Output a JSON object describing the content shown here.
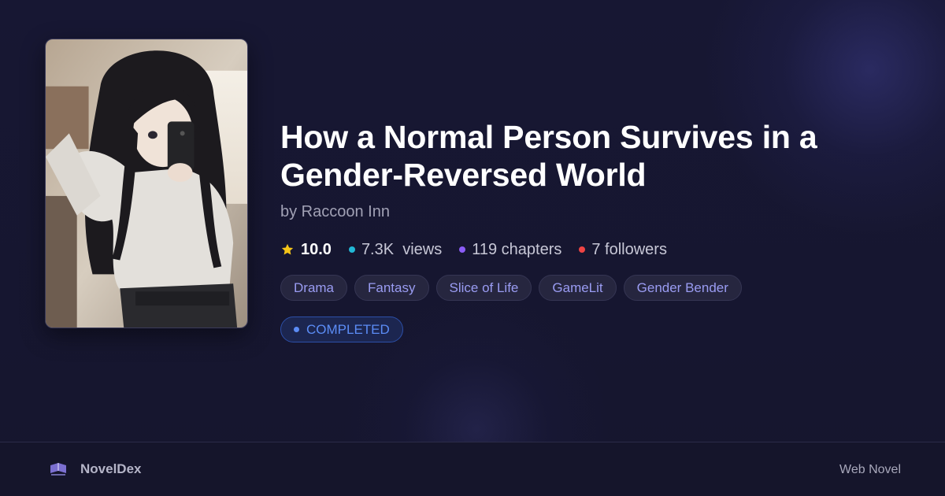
{
  "novel": {
    "title": "How a Normal Person Survives in a Gender-Reversed World",
    "author_line": "by Raccoon Inn",
    "rating": "10.0",
    "views": "7.3K  views",
    "chapters": "119 chapters",
    "followers": "7 followers",
    "genres": [
      "Drama",
      "Fantasy",
      "Slice of Life",
      "GameLit",
      "Gender Bender"
    ],
    "status": "COMPLETED"
  },
  "icons": {
    "rating": "star-icon",
    "views": "dot-icon",
    "chapters": "dot-icon",
    "followers": "dot-icon"
  },
  "colors": {
    "rating_star": "#f5c518",
    "views_dot": "#22b8d6",
    "chapters_dot": "#8b5cf6",
    "followers_dot": "#ef4444",
    "genre_text": "#9a9cf2",
    "status": "#5b8cf5",
    "background": "#16162e"
  },
  "footer": {
    "brand": "NovelDex",
    "category": "Web Novel"
  }
}
